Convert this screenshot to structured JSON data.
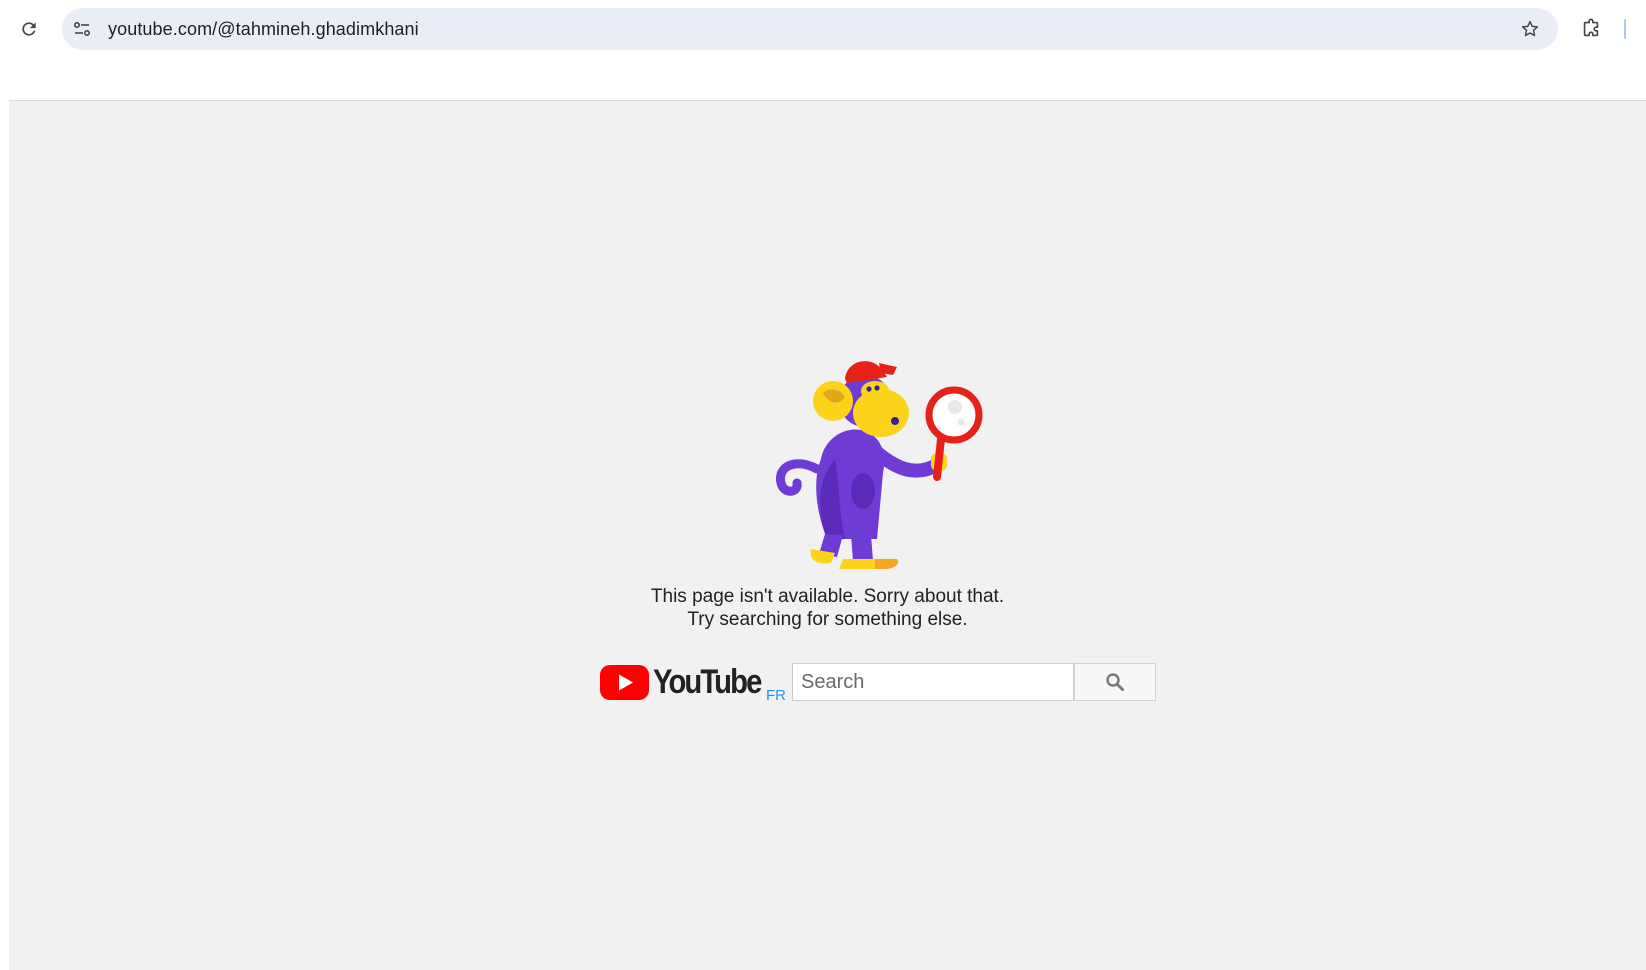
{
  "browser": {
    "url": "youtube.com/@tahmineh.ghadimkhani",
    "icons": {
      "reload": "reload-icon",
      "site_info": "tune-icon",
      "bookmark": "star-icon",
      "extensions": "puzzle-icon"
    }
  },
  "page": {
    "illustration": "monkey-with-magnifying-glass",
    "message_line1": "This page isn't available. Sorry about that.",
    "message_line2": "Try searching for something else.",
    "logo_text": "YouTube",
    "country_code": "FR",
    "search_placeholder": "Search",
    "search_value": "",
    "search_button_icon": "search-icon"
  },
  "colors": {
    "page_background": "#f1f1f1",
    "omnibox_background": "#e9eef6",
    "youtube_red": "#ff0000",
    "country_code": "#2793e6",
    "monkey_purple": "#6f3bd5",
    "monkey_yellow": "#fbd31b",
    "cap_red": "#e62117"
  }
}
